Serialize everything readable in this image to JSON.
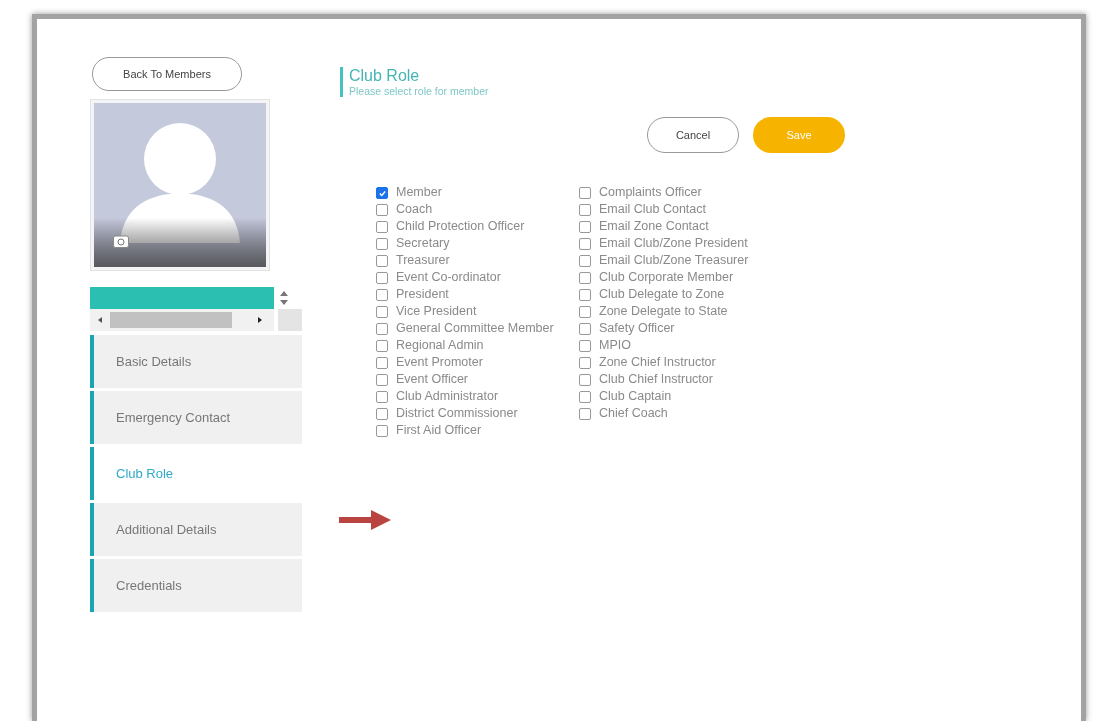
{
  "back_button": {
    "label": "Back To Members"
  },
  "sidebar": {
    "items": [
      {
        "label": "Basic Details",
        "selected": false
      },
      {
        "label": "Emergency Contact",
        "selected": false
      },
      {
        "label": "Club Role",
        "selected": true
      },
      {
        "label": "Additional Details",
        "selected": false
      },
      {
        "label": "Credentials",
        "selected": false
      }
    ]
  },
  "section": {
    "title": "Club Role",
    "subtitle": "Please select role for member"
  },
  "buttons": [
    {
      "label": "Cancel",
      "kind": "secondary"
    },
    {
      "label": "Save",
      "kind": "primary"
    }
  ],
  "roles": {
    "column_1": [
      {
        "label": "Member",
        "checked": true
      },
      {
        "label": "Coach",
        "checked": false
      },
      {
        "label": "Child Protection Officer",
        "checked": false
      },
      {
        "label": "Secretary",
        "checked": false
      },
      {
        "label": "Treasurer",
        "checked": false
      },
      {
        "label": "Event Co-ordinator",
        "checked": false
      },
      {
        "label": "President",
        "checked": false
      },
      {
        "label": "Vice President",
        "checked": false
      },
      {
        "label": "General Committee Member",
        "checked": false
      },
      {
        "label": "Regional Admin",
        "checked": false
      },
      {
        "label": "Event Promoter",
        "checked": false
      },
      {
        "label": "Event Officer",
        "checked": false
      },
      {
        "label": "Club Administrator",
        "checked": false
      },
      {
        "label": "District Commissioner",
        "checked": false
      },
      {
        "label": "First Aid Officer",
        "checked": false
      }
    ],
    "column_2": [
      {
        "label": "Complaints Officer",
        "checked": false
      },
      {
        "label": "Email Club Contact",
        "checked": false
      },
      {
        "label": "Email Zone Contact",
        "checked": false
      },
      {
        "label": "Email Club/Zone President",
        "checked": false
      },
      {
        "label": "Email Club/Zone Treasurer",
        "checked": false
      },
      {
        "label": "Club Corporate Member",
        "checked": false
      },
      {
        "label": "Club Delegate to Zone",
        "checked": false
      },
      {
        "label": "Zone Delegate to State",
        "checked": false
      },
      {
        "label": "Safety Officer",
        "checked": false
      },
      {
        "label": "MPIO",
        "checked": false
      },
      {
        "label": "Zone Chief Instructor",
        "checked": false
      },
      {
        "label": "Club Chief Instructor",
        "checked": false
      },
      {
        "label": "Club Captain",
        "checked": false
      },
      {
        "label": "Chief Coach",
        "checked": false
      }
    ]
  }
}
